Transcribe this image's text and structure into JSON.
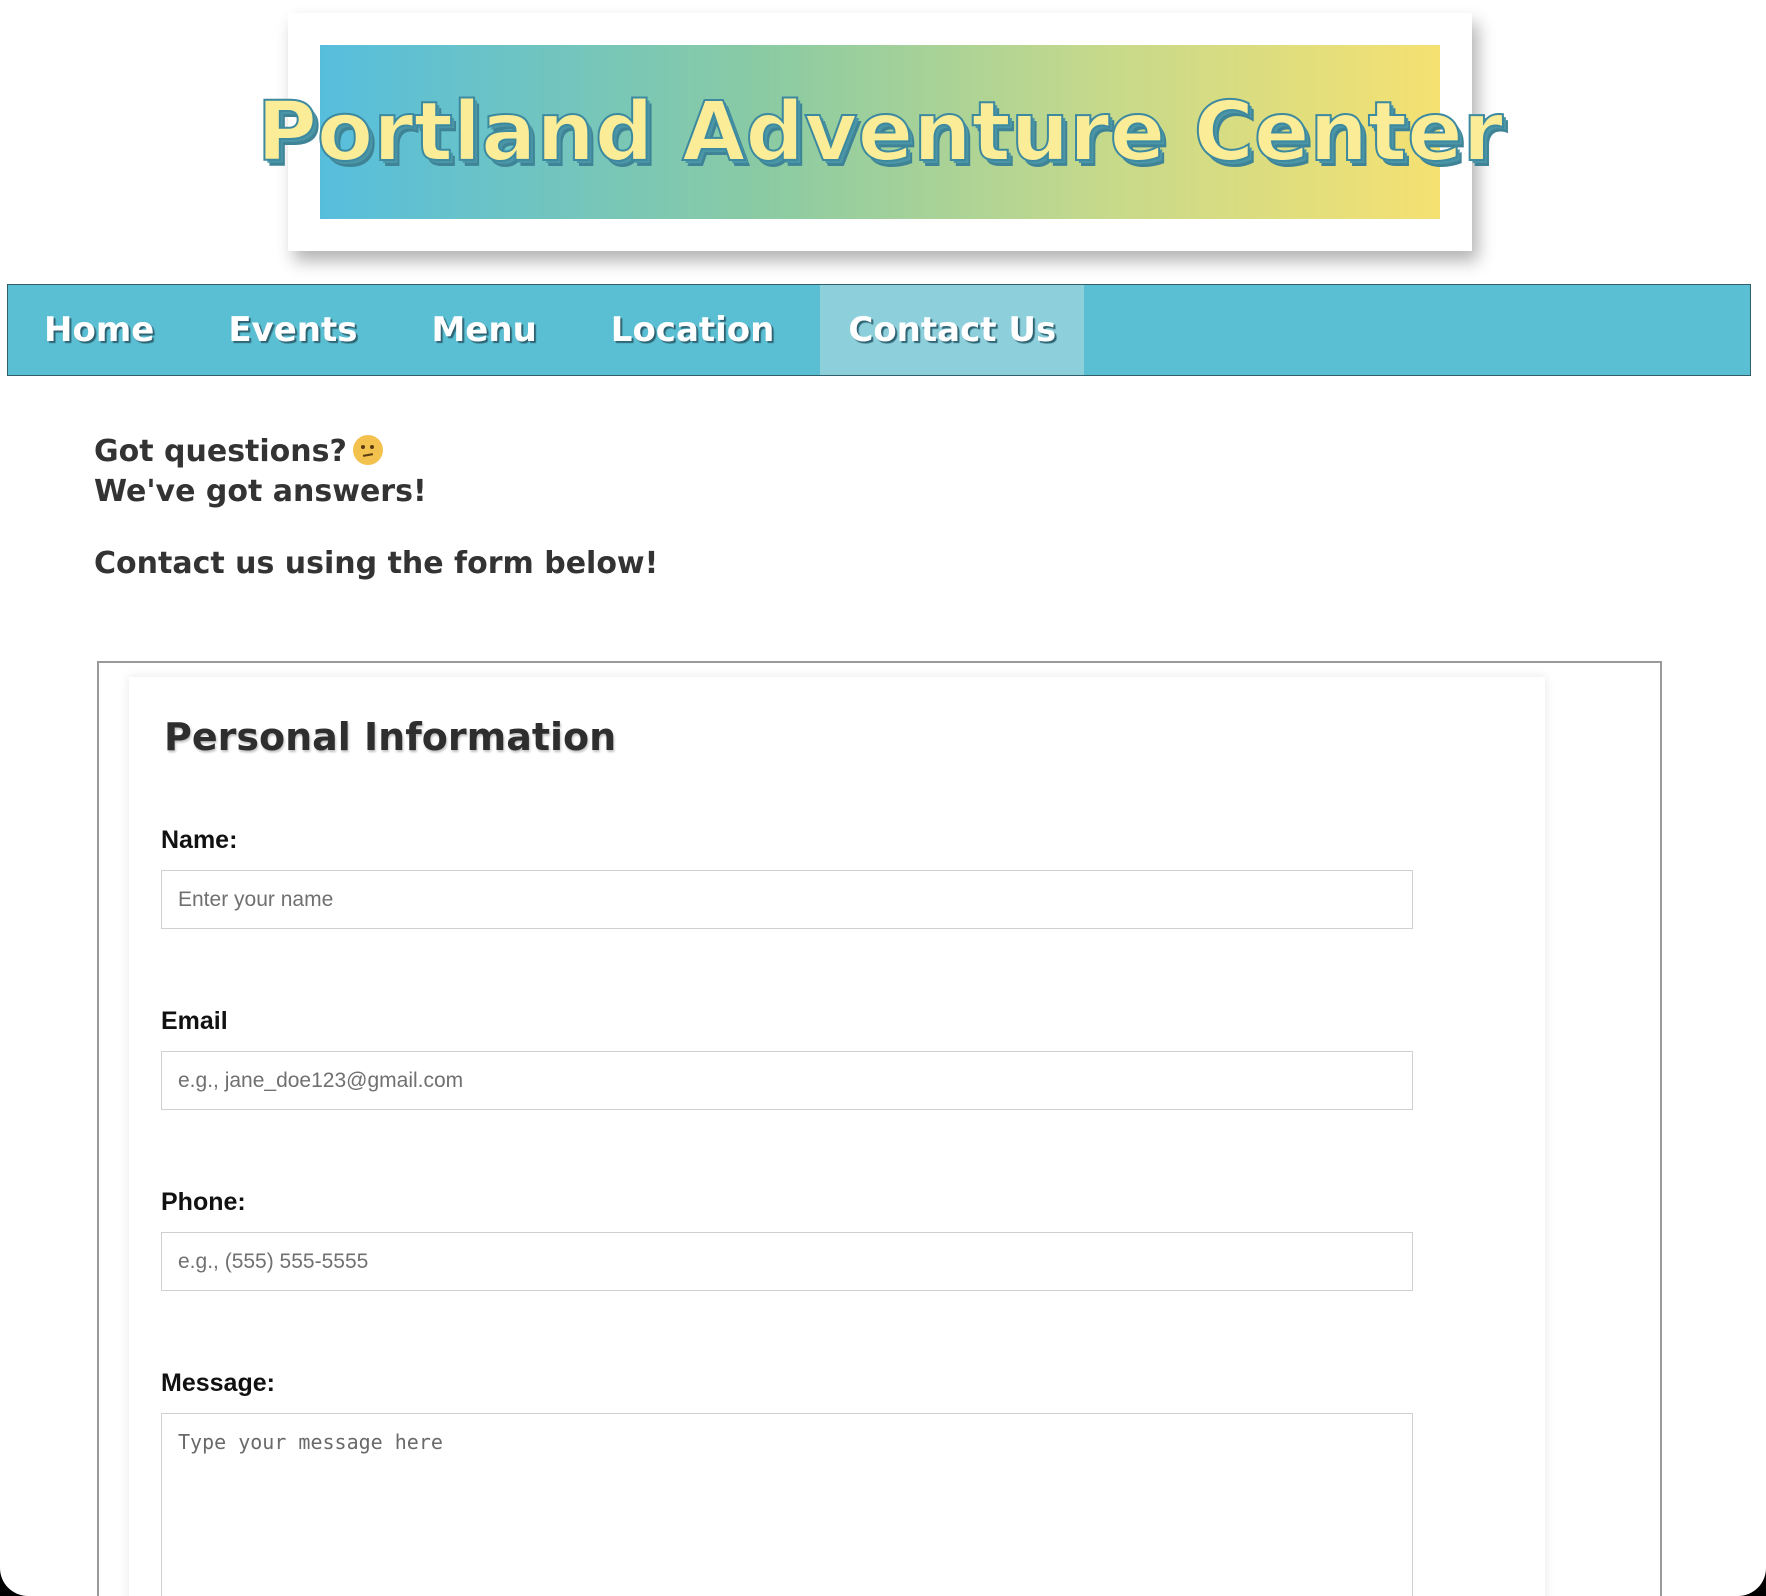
{
  "header": {
    "title": "Portland Adventure Center"
  },
  "nav": {
    "items": [
      {
        "label": "Home"
      },
      {
        "label": "Events"
      },
      {
        "label": "Menu"
      },
      {
        "label": "Location"
      },
      {
        "label": "Contact Us"
      }
    ],
    "active": "Contact Us"
  },
  "intro": {
    "line1": "Got questions?",
    "line1_icon": "thinking-face-icon",
    "line2": "We've got answers!",
    "line3": "Contact us using the form below!"
  },
  "form": {
    "section_title": "Personal Information",
    "fields": {
      "name": {
        "label": "Name:",
        "placeholder": "Enter your name",
        "value": ""
      },
      "email": {
        "label": "Email",
        "placeholder": "e.g., jane_doe123@gmail.com",
        "value": ""
      },
      "phone": {
        "label": "Phone:",
        "placeholder": "e.g., (555) 555-5555",
        "value": ""
      },
      "message": {
        "label": "Message:",
        "placeholder": "Type your message here",
        "value": ""
      }
    }
  },
  "colors": {
    "nav_bg": "#5bbfd3",
    "nav_active_bg": "#8dd0dc",
    "banner_start": "#56bedd",
    "banner_end": "#f5e172",
    "banner_text": "#fbec97"
  }
}
